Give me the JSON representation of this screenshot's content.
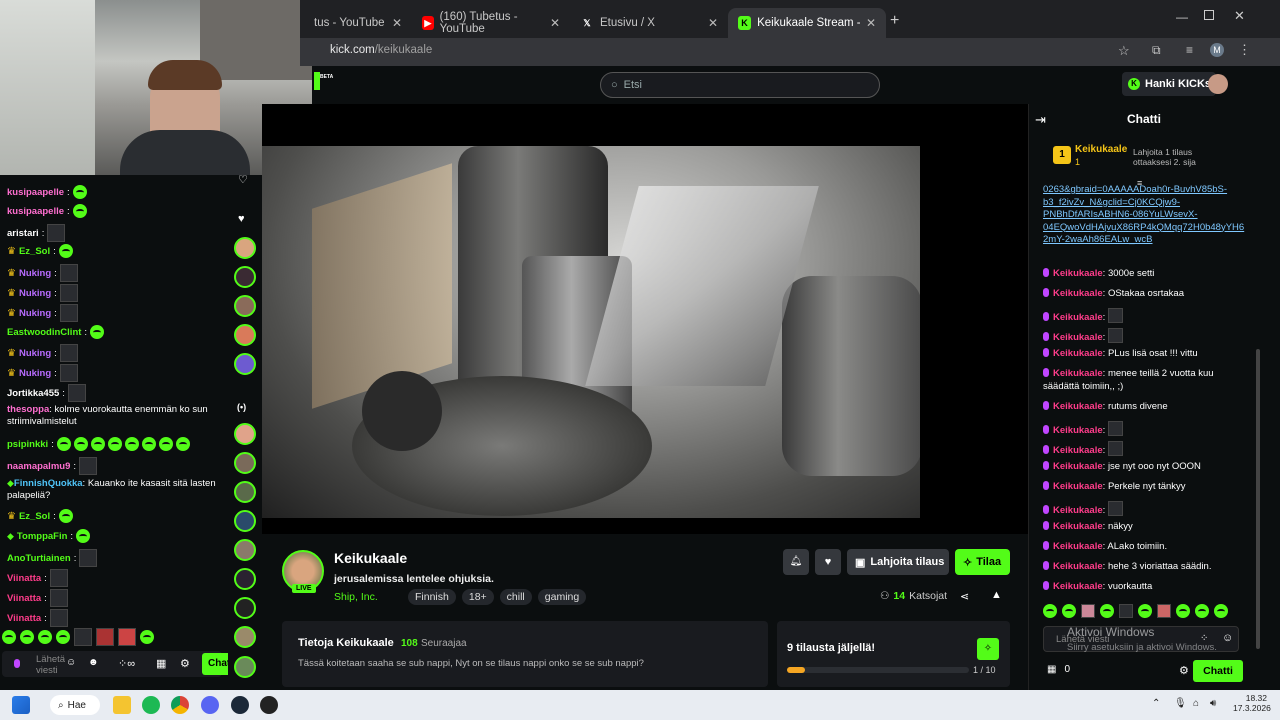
{
  "browser": {
    "tabs": [
      {
        "title": "tus - YouTube",
        "favicon": "youtube"
      },
      {
        "title": "(160) Tubetus - YouTube",
        "favicon": "youtube"
      },
      {
        "title": "Etusivu / X",
        "favicon": "x"
      },
      {
        "title": "Keikukaale Stream - Watch Live",
        "favicon": "kick",
        "active": true
      }
    ],
    "url_host": "kick.com",
    "url_path": "/keikukaale",
    "profile_initial": "M"
  },
  "header": {
    "search_placeholder": "Etsi",
    "get_kicks_label": "Hanki KICKs",
    "beta_label": "BETA"
  },
  "left_chat": [
    {
      "user": "kusipaapelle",
      "color": "#ff6fd0",
      "emotes": [
        "green"
      ]
    },
    {
      "user": "kusipaapelle",
      "color": "#ff6fd0",
      "emotes": [
        "green"
      ]
    },
    {
      "user": "aristari",
      "color": "#ffffff",
      "emotes": [
        "dark"
      ]
    },
    {
      "user": "Ez_Sol",
      "color": "#53fc18",
      "emotes": [
        "green"
      ],
      "badge": "crown"
    },
    {
      "user": "Nuking",
      "color": "#b86cff",
      "emotes": [
        "dark"
      ],
      "badge": "crown"
    },
    {
      "user": "Nuking",
      "color": "#b86cff",
      "emotes": [
        "dark"
      ],
      "badge": "crown"
    },
    {
      "user": "Nuking",
      "color": "#b86cff",
      "emotes": [
        "dark"
      ],
      "badge": "crown"
    },
    {
      "user": "EastwoodinClint",
      "color": "#53fc18",
      "emotes": [
        "green"
      ]
    },
    {
      "user": "Nuking",
      "color": "#b86cff",
      "emotes": [
        "dark"
      ],
      "badge": "crown"
    },
    {
      "user": "Nuking",
      "color": "#b86cff",
      "emotes": [
        "dark"
      ],
      "badge": "crown"
    },
    {
      "user": "Jortikka455",
      "color": "#ffffff",
      "emotes": [
        "dark"
      ]
    },
    {
      "user": "thesoppa",
      "color": "#ff6fd0",
      "text": "kolme vuorokautta enemmän ko sun striimivalmistelut"
    },
    {
      "user": "psipinkki",
      "color": "#53fc18",
      "emotes": [
        "green",
        "green",
        "green",
        "green",
        "green",
        "green",
        "green",
        "green"
      ]
    },
    {
      "user": "naamapalmu9",
      "color": "#ff6fd0",
      "emotes": [
        "dark"
      ]
    },
    {
      "user": "FinnishQuokka",
      "color": "#4fc3f7",
      "text": "Kauanko ite kasasit sitä lasten palapeliä?",
      "badge": "green"
    },
    {
      "user": "Ez_Sol",
      "color": "#53fc18",
      "emotes": [
        "green"
      ],
      "badge": "crown"
    },
    {
      "user": "TomppaFin",
      "color": "#53fc18",
      "emotes": [
        "green"
      ],
      "badge": "green"
    },
    {
      "user": "AnoTurtiainen",
      "color": "#53fc18",
      "emotes": [
        "dark"
      ]
    },
    {
      "user": "Viinatta",
      "color": "#ff3d8b",
      "emotes": [
        "dark"
      ]
    },
    {
      "user": "Viinatta",
      "color": "#ff3d8b",
      "emotes": [
        "dark"
      ]
    },
    {
      "user": "Viinatta",
      "color": "#ff3d8b",
      "emotes": [
        "dark"
      ]
    }
  ],
  "left_chat_input": {
    "placeholder": "Lähetä viesti",
    "send_label": "Chatti"
  },
  "stream": {
    "channel": "Keikukaale",
    "title": "jerusalemissa lentelee ohjuksia.",
    "category": "Ship, Inc.",
    "tags": [
      "Finnish",
      "18+",
      "chill",
      "gaming"
    ],
    "live_label": "LIVE",
    "viewers": "14",
    "viewers_label": "Katsojat",
    "gift_label": "Lahjoita tilaus",
    "subscribe_label": "Tilaa"
  },
  "about": {
    "title": "Tietoja Keikukaale",
    "followers": "108",
    "followers_label": "Seuraajaa",
    "text": "Tässä koitetaan saaha se sub nappi, Nyt on se tilaus nappi onko se se sub nappi?"
  },
  "subs_goal": {
    "title": "9 tilausta jäljellä!",
    "progress_text": "1 / 10",
    "progress": 0.1
  },
  "right_chat": {
    "title": "Chatti",
    "leader_rank": "1",
    "leader_name": "Keikukaale",
    "leader_count": "1",
    "gift_prompt": "Lahjoita 1 tilaus ottaaksesi 2. sija",
    "link_lines": [
      "0263&gbraid=0AAAAADoah0r-BuvhV85bS-",
      "b3_f2ivZv_N&gclid=Cj0KCQjw9-",
      "PNBhDfARIsABHN6-086YuLWsevX-",
      "04EQwoVdHAjvuX86RP4kQMqq72H0b48yYH6",
      "2mY-2waAh86EALw_wcB"
    ],
    "messages": [
      {
        "user": "Keikukaale",
        "text": "3000e setti"
      },
      {
        "user": "Keikukaale",
        "text": "OStakaa osrtakaa"
      },
      {
        "user": "Keikukaale",
        "text": ""
      },
      {
        "user": "Keikukaale",
        "text": ""
      },
      {
        "user": "Keikukaale",
        "text": "PLus lisä osat !!! vittu"
      },
      {
        "user": "Keikukaale",
        "text": "menee teillä 2 vuotta kuu säädättä toimiin,, ;)"
      },
      {
        "user": "Keikukaale",
        "text": "rutums divene"
      },
      {
        "user": "Keikukaale",
        "text": ""
      },
      {
        "user": "Keikukaale",
        "text": ""
      },
      {
        "user": "Keikukaale",
        "text": "jse nyt ooo nyt OOON"
      },
      {
        "user": "Keikukaale",
        "text": "Perkele nyt tänkyy"
      },
      {
        "user": "Keikukaale",
        "text": ""
      },
      {
        "user": "Keikukaale",
        "text": "näkyy"
      },
      {
        "user": "Keikukaale",
        "text": "ALako toimiin."
      },
      {
        "user": "Keikukaale",
        "text": "hehe 3 vioriattaa säädin."
      },
      {
        "user": "Keikukaale",
        "text": "vuorkautta"
      }
    ],
    "input_placeholder": "Lähetä viesti",
    "points": "0",
    "send_label": "Chatti",
    "watermark_title": "Aktivoi Windows",
    "watermark_sub": "Siirry asetuksiin ja aktivoi Windows."
  },
  "taskbar": {
    "search_label": "Hae",
    "time": "18.32",
    "date": "17.3.2026"
  },
  "colors": {
    "kick_green": "#53fc18",
    "bg": "#0b0e0f",
    "panel": "#191b1f",
    "name_pink": "#ff3d8b"
  }
}
